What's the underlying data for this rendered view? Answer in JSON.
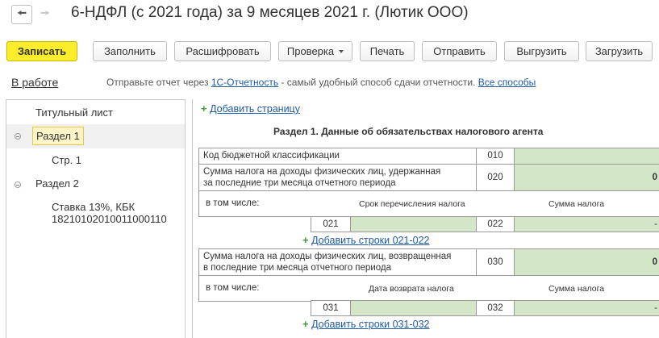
{
  "window": {
    "title": "6-НДФЛ (с 2021 года) за 9 месяцев 2021 г. (Лютик ООО)",
    "back_icon": "arrow-left-icon",
    "forward_icon": "arrow-right-icon"
  },
  "toolbar": {
    "save": "Записать",
    "fill": "Заполнить",
    "decode": "Расшифровать",
    "check": "Проверка",
    "print": "Печать",
    "send": "Отправить",
    "export": "Выгрузить",
    "import": "Загрузить"
  },
  "status_bar": {
    "status": "В работе",
    "hint_before": "Отправьте отчет через ",
    "hint_link": "1С-Отчетность",
    "hint_middle": " - самый удобный способ сдачи отчетности. ",
    "hint_link2": "Все способы"
  },
  "tree": {
    "items": [
      {
        "label": "Титульный лист"
      },
      {
        "label": "Раздел 1"
      },
      {
        "label": "Стр. 1"
      },
      {
        "label": "Раздел 2"
      },
      {
        "label_line1": "Ставка 13%, КБК",
        "label_line2": "18210102010011000110"
      }
    ]
  },
  "form": {
    "add_page": "Добавить страницу",
    "section_title": "Раздел 1. Данные об обязательствах налогового агента",
    "row_010_label": "Код бюджетной классификации",
    "row_010_code": "010",
    "row_010_value": "",
    "row_020_label_1": "Сумма налога на доходы физических лиц, удержанная",
    "row_020_label_2": "за последние три месяца отчетного периода",
    "row_020_code": "020",
    "row_020_value": "0",
    "incl_label_1": "в том числе:",
    "col_term": "Срок перечисления налога",
    "col_sum_1": "Сумма налога",
    "code_021": "021",
    "code_022": "022",
    "dash_1": "-",
    "add_rows_021": "Добавить строки 021-022",
    "row_030_label_1": "Сумма налога на доходы физических лиц, возвращенная",
    "row_030_label_2": "в последние три месяца отчетного периода",
    "row_030_code": "030",
    "row_030_value": "0",
    "incl_label_2": "в том числе:",
    "col_return_date": "Дата возврата налога",
    "col_sum_2": "Сумма налога",
    "code_031": "031",
    "code_032": "032",
    "dash_2": "-",
    "add_rows_031": "Добавить строки 031-032"
  },
  "colors": {
    "primary_button": "#fbed2c",
    "link": "#1f5aa6",
    "input_fill": "#d4e6c8",
    "selection": "#fdf4c7"
  }
}
